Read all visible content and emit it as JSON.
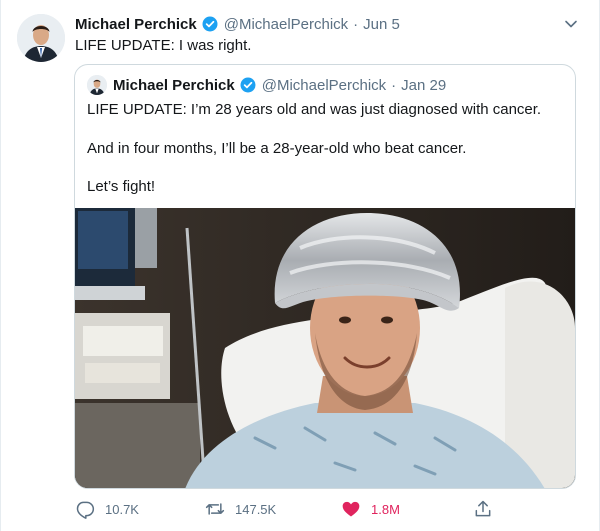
{
  "tweet": {
    "author": {
      "name": "Michael Perchick",
      "handle": "@MichaelPerchick"
    },
    "separator": "·",
    "date": "Jun 5",
    "text": "LIFE UPDATE: I was right."
  },
  "quoted_tweet": {
    "author": {
      "name": "Michael Perchick",
      "handle": "@MichaelPerchick"
    },
    "separator": "·",
    "date": "Jan 29",
    "lines": [
      "LIFE UPDATE: I’m 28 years old and was just diagnosed with cancer.",
      "And in four months, I’ll be a 28-year-old who beat cancer.",
      "Let’s fight!"
    ]
  },
  "actions": {
    "reply_count": "10.7K",
    "retweet_count": "147.5K",
    "like_count": "1.8M"
  },
  "icons": {
    "verified": "verified-badge-icon",
    "caret": "chevron-down-icon",
    "reply": "reply-icon",
    "retweet": "retweet-icon",
    "like": "heart-icon",
    "share": "share-icon"
  },
  "colors": {
    "verified": "#1da1f2",
    "secondary_text": "#5b7083",
    "like_active": "#e0245e",
    "border": "#cfd9de"
  }
}
